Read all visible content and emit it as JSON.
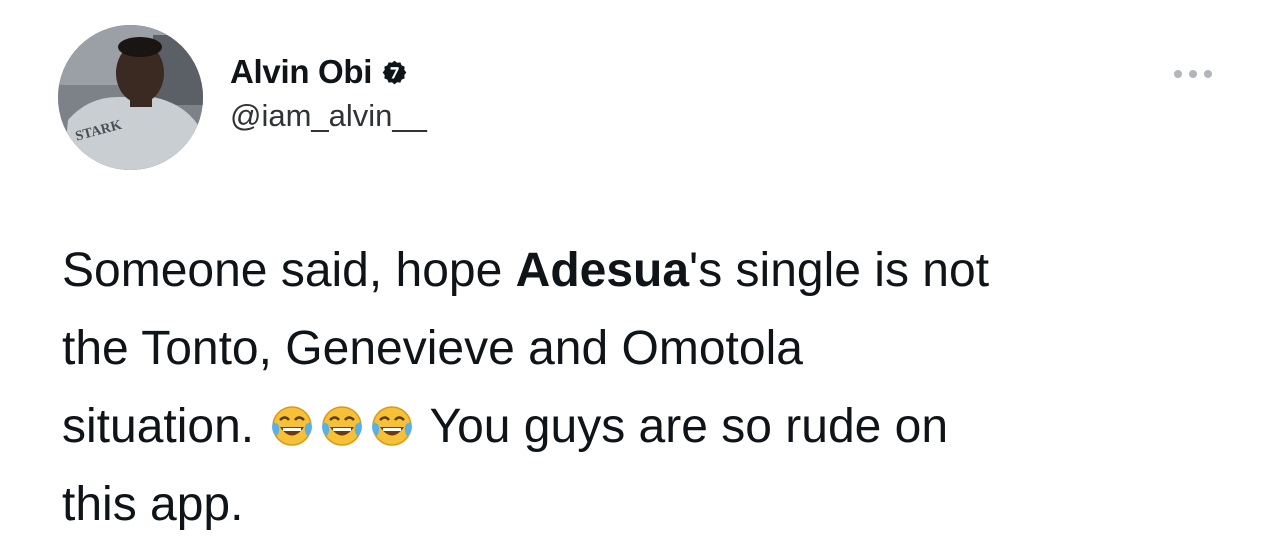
{
  "author": {
    "display_name": "Alvin Obi",
    "handle": "@iam_alvin__",
    "verified_icon": "verified-badge-icon",
    "avatar_shirt_text": "STARK"
  },
  "menu": {
    "more_icon": "more-horizontal-icon"
  },
  "tweet": {
    "line1_before": "Someone said, hope ",
    "line1_bold": "Adesua",
    "line1_after": "'s single is not",
    "line2": "the Tonto, Genevieve and Omotola",
    "line3_before": "situation.",
    "emojis": [
      "face-with-tears-of-joy-icon",
      "face-with-tears-of-joy-icon",
      "face-with-tears-of-joy-icon"
    ],
    "line3_after": "You guys are so rude on",
    "line4": "this app."
  },
  "colors": {
    "text": "#0f1419",
    "handle": "#2f3336",
    "more_dots": "#b0b6bb",
    "background": "#ffffff"
  }
}
